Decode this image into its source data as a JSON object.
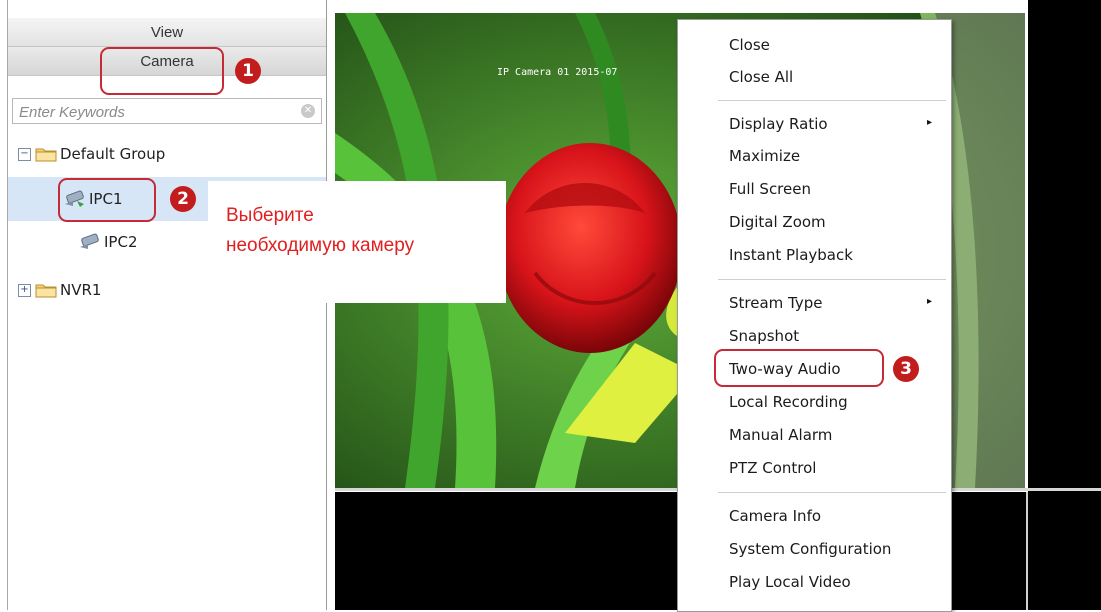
{
  "left_panel": {
    "view_label": "View",
    "camera_label": "Camera",
    "search_placeholder": "Enter Keywords",
    "tree": {
      "group_label": "Default Group",
      "group_expander": "−",
      "cameras": [
        "IPC1",
        "IPC2"
      ],
      "nvr_label": "NVR1",
      "nvr_expander": "+"
    }
  },
  "note": {
    "line1": "Выберите",
    "line2": "необходимую камеру"
  },
  "badges": [
    "1",
    "2",
    "3"
  ],
  "video": {
    "osd_text": "IP Camera 01  2015-07"
  },
  "context_menu": {
    "items": [
      "Close",
      "Close All",
      "Display Ratio",
      "Maximize",
      "Full Screen",
      "Digital Zoom",
      "Instant Playback",
      "Stream Type",
      "Snapshot",
      "Two-way Audio",
      "Local Recording",
      "Manual Alarm",
      "PTZ Control",
      "Camera Info",
      "System Configuration",
      "Play Local Video"
    ],
    "submenu_arrow": "▸"
  },
  "colors": {
    "callout": "#c52b36",
    "badge": "#c21c1c",
    "note_text": "#e02020",
    "selection": "#d6e6f6"
  }
}
